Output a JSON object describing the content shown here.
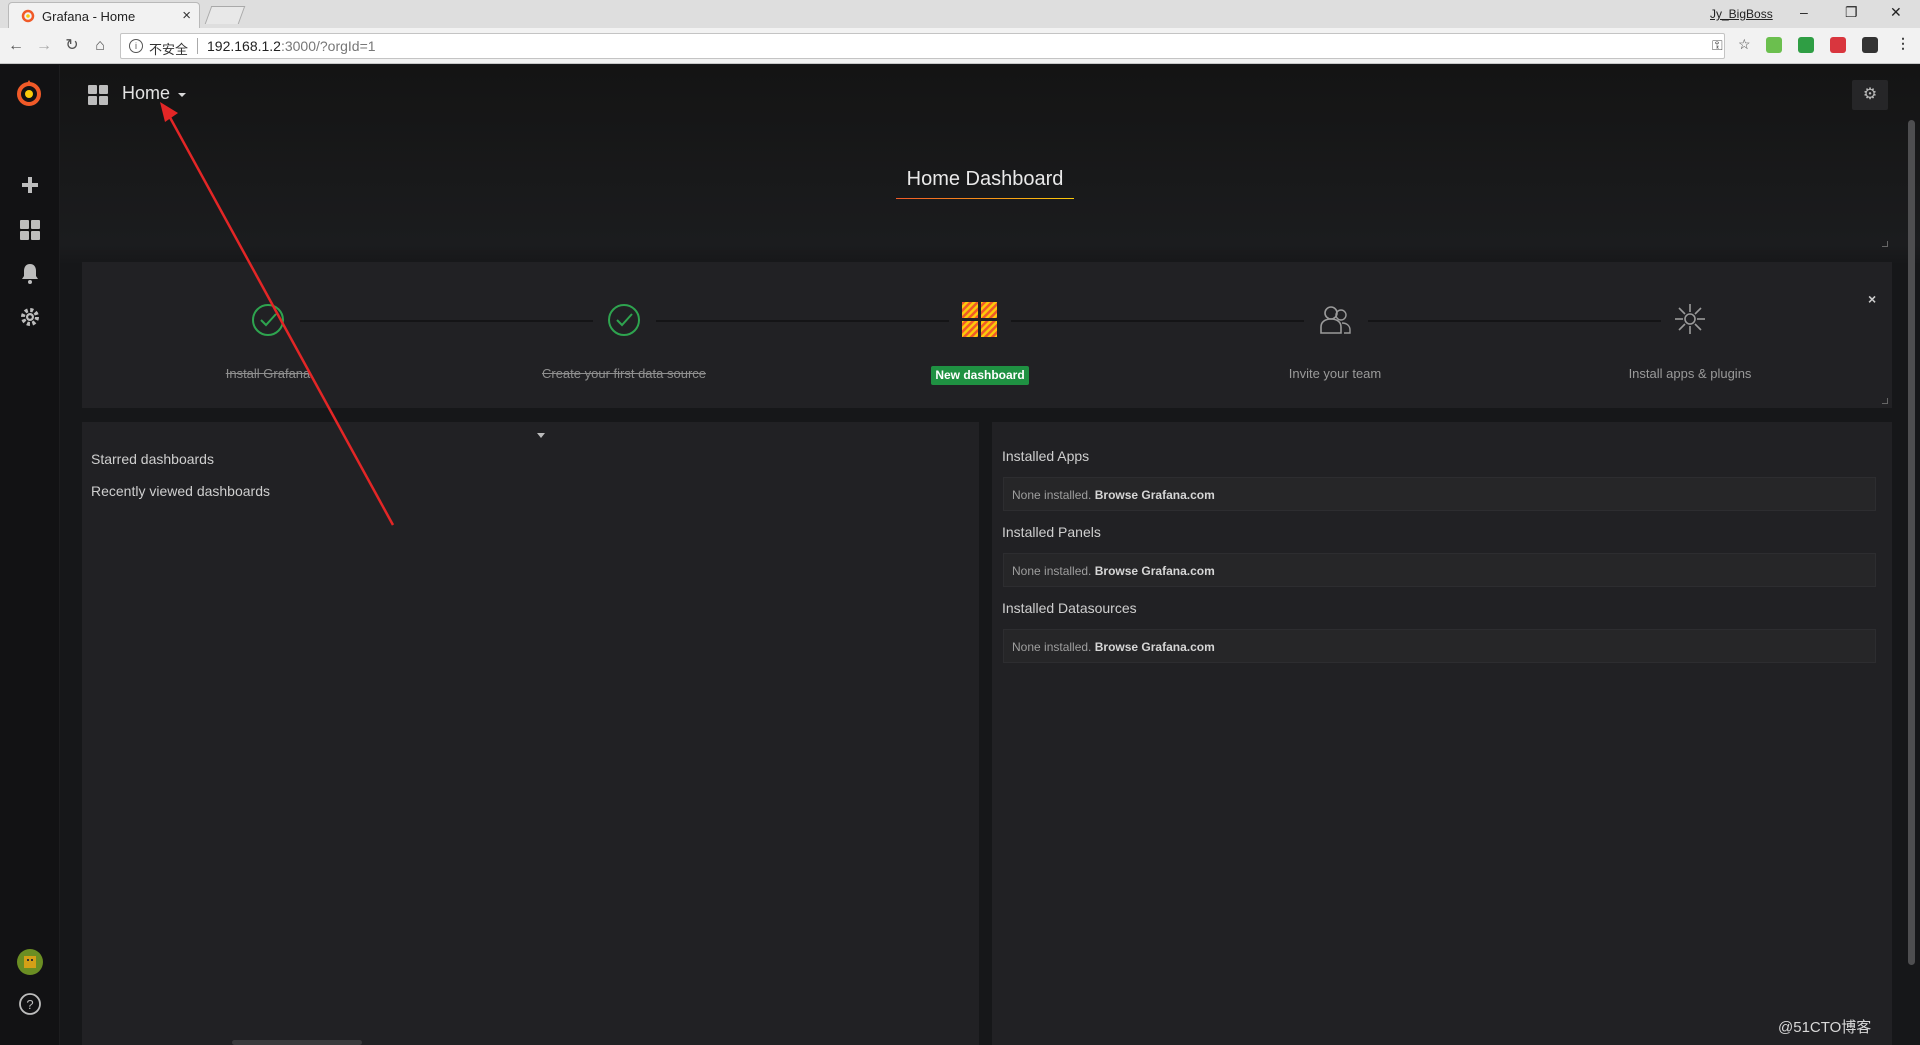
{
  "browser": {
    "tab_title": "Grafana - Home",
    "tab_close": "×",
    "user": "Jy_BigBoss",
    "win_min": "–",
    "win_max": "❐",
    "win_close": "✕",
    "insecure_label": "不安全",
    "url_host": "192.168.1.2",
    "url_rest": ":3000/?orgId=1"
  },
  "navbar": {
    "title": "Home"
  },
  "dashboard": {
    "title": "Home Dashboard"
  },
  "getting_started": {
    "close_label": "×",
    "steps": [
      {
        "label": "Install Grafana",
        "state": "done"
      },
      {
        "label": "Create your first data source",
        "state": "done"
      },
      {
        "label": "New dashboard",
        "state": "active"
      },
      {
        "label": "Invite your team",
        "state": "todo"
      },
      {
        "label": "Install apps & plugins",
        "state": "todo"
      }
    ]
  },
  "dashlist": {
    "starred": "Starred dashboards",
    "recent": "Recently viewed dashboards"
  },
  "plugins": {
    "apps_title": "Installed Apps",
    "panels_title": "Installed Panels",
    "datasources_title": "Installed Datasources",
    "none_text": "None installed.",
    "browse_link": "Browse Grafana.com"
  },
  "watermark": "@51CTO博客",
  "colors": {
    "grafana_orange": "#f05a28",
    "success_green": "#1f9142",
    "panel_bg": "#212124"
  }
}
